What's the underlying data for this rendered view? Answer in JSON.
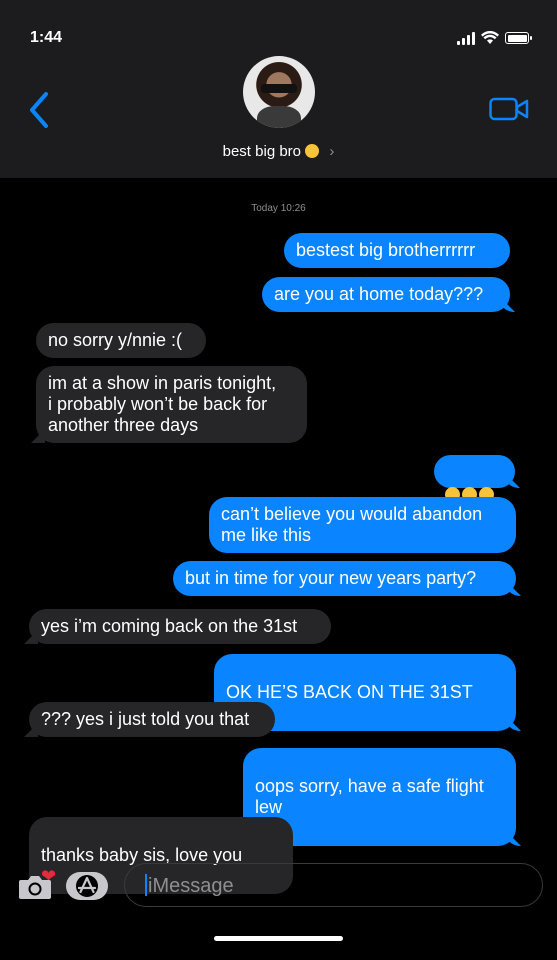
{
  "status": {
    "time": "1:44"
  },
  "header": {
    "contact_name": "best big bro",
    "chevron": "›"
  },
  "thread": {
    "timestamp": "Today 10:26",
    "messages": [
      {
        "dir": "out",
        "text": "bestest big brotherrrrrr"
      },
      {
        "dir": "out",
        "text": "are you at home today???"
      },
      {
        "dir": "in",
        "text": "no sorry y/nnie :("
      },
      {
        "dir": "in",
        "text": "im at a show in paris tonight,\ni probably won’t be back for\nanother three days"
      },
      {
        "dir": "out",
        "text": "😔😔😔"
      },
      {
        "dir": "out",
        "text": "can’t believe you would abandon\nme like this"
      },
      {
        "dir": "out",
        "text": "but in time for your new years party?"
      },
      {
        "dir": "in",
        "text": "yes i’m coming back on the 31st"
      },
      {
        "dir": "out",
        "text": "OK HE’S BACK ON THE 31ST"
      },
      {
        "dir": "in",
        "text": "??? yes i just told you that"
      },
      {
        "dir": "out",
        "text": "oops sorry, have a safe flight\nlew"
      },
      {
        "dir": "in",
        "text": "thanks baby sis, love you"
      }
    ]
  },
  "composer": {
    "placeholder": "iMessage"
  },
  "colors": {
    "outgoing": "#0a84ff",
    "incoming": "#262628",
    "header_bg": "#1c1c1e"
  }
}
